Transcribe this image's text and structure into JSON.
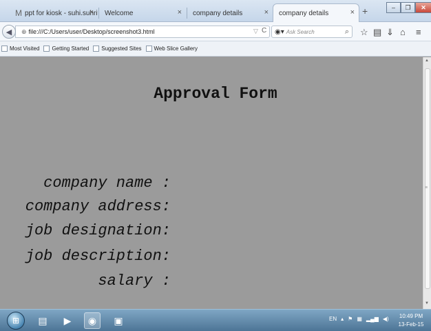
{
  "browser": {
    "tabs": [
      {
        "label": "ppt for kiosk - suhi.suhrita...",
        "close": "×"
      },
      {
        "label": "Welcome",
        "close": "×"
      },
      {
        "label": "company details",
        "close": "×"
      },
      {
        "label": "company details",
        "close": "×",
        "active": true
      }
    ],
    "new_tab": "+",
    "window_buttons": {
      "minimize": "–",
      "maximize": "❐",
      "close": "✕"
    },
    "url": "file:///C:/Users/user/Desktop/screenshot3.html",
    "search_placeholder": "Ask Search",
    "bookmarks": [
      "Most Visited",
      "Getting Started",
      "Suggested Sites",
      "Web Slice Gallery"
    ]
  },
  "page": {
    "title": "Approval Form",
    "fields": [
      "company name :",
      "company address:",
      "job designation:",
      "job description:",
      "salary :"
    ]
  },
  "taskbar": {
    "language": "EN",
    "time": "10:49 PM",
    "date": "13-Feb-15"
  },
  "icons": {
    "back": "back-arrow-icon",
    "reload": "reload-icon",
    "search": "search-icon",
    "bookmark_star": "star-icon",
    "reading_list": "reading-list-icon",
    "download": "download-icon",
    "home": "home-icon",
    "menu": "hamburger-menu-icon"
  }
}
